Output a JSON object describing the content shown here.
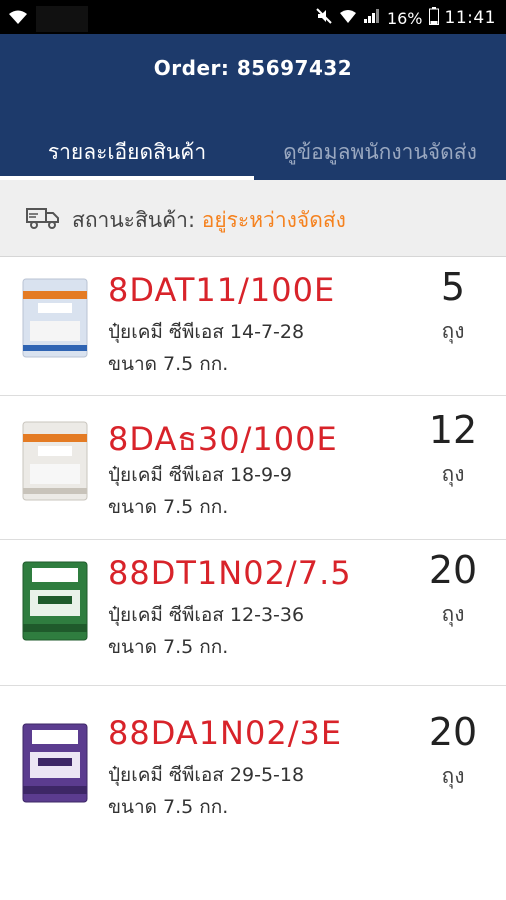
{
  "status_bar": {
    "battery": "16%",
    "time": "11:41"
  },
  "header": {
    "order_title": "Order: 85697432",
    "tabs": [
      {
        "label": "รายละเอียดสินค้า",
        "active": true
      },
      {
        "label": "ดูข้อมูลพนักงานจัดส่ง",
        "active": false
      }
    ]
  },
  "status": {
    "icon": "truck-icon",
    "label": "สถานะสินค้า: ",
    "value": "อยู่ระหว่างจัดส่ง"
  },
  "colors": {
    "header_bg": "#1d3a6b",
    "code_red": "#d8232a",
    "status_orange": "#f5821f"
  },
  "items": [
    {
      "code": "8DAT11/100E",
      "name": "ปุ๋ยเคมี ซีพีเอส 14-7-28",
      "size": "ขนาด 7.5 กก.",
      "qty": "5",
      "unit": "ถุง",
      "label_text": "14-7-28",
      "bag_color": "#d9e2ef",
      "stripe_color": "#e47b24"
    },
    {
      "code": "8DAธ30/100E",
      "name": "ปุ๋ยเคมี ซีพีเอส 18-9-9",
      "size": "ขนาด 7.5 กก.",
      "qty": "12",
      "unit": "ถุง",
      "label_text": "18-9-9",
      "bag_color": "#eceae6",
      "stripe_color": "#e47b24"
    },
    {
      "code": "88DT1N02/7.5",
      "name": "ปุ๋ยเคมี ซีพีเอส 12-3-36",
      "size": "ขนาด 7.5 กก.",
      "qty": "20",
      "unit": "ถุง",
      "label_text": "12-3-36",
      "bag_color": "#2f7d3f",
      "stripe_color": "#1f5a2b"
    },
    {
      "code": "88DA1N02/3E",
      "name": "ปุ๋ยเคมี ซีพีเอส 29-5-18",
      "size": "ขนาด 7.5 กก.",
      "qty": "20",
      "unit": "ถุง",
      "label_text": "29-5-18",
      "bag_color": "#5b3c8f",
      "stripe_color": "#3d2766"
    }
  ]
}
